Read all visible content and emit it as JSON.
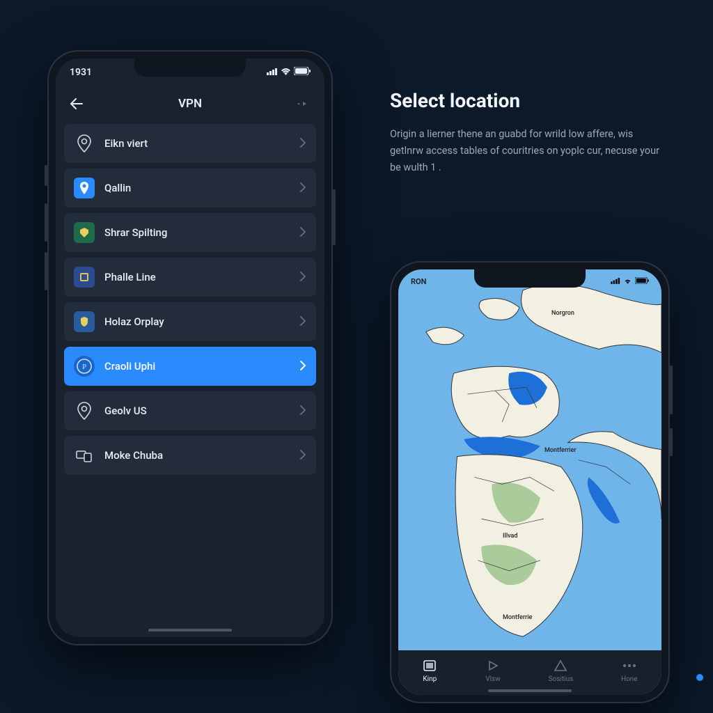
{
  "left_phone": {
    "status_time": "1931",
    "header_title": "VPN",
    "items": [
      {
        "label": "Eikn viert",
        "selected": false,
        "icon_name": "location-pin-outline-icon",
        "icon_bg": "transparent",
        "icon_fg": "#cfd8e3",
        "glyph": "◉"
      },
      {
        "label": "Qallin",
        "selected": false,
        "icon_name": "location-pin-filled-icon",
        "icon_bg": "#2a8bff",
        "icon_fg": "#ffffff",
        "glyph": "⦿"
      },
      {
        "label": "Shrar Spilting",
        "selected": false,
        "icon_name": "shield-emblem-icon",
        "icon_bg": "#1e6b4a",
        "icon_fg": "#e8d060",
        "glyph": "⬢"
      },
      {
        "label": "Phalle Line",
        "selected": false,
        "icon_name": "crest-icon",
        "icon_bg": "#2a4b8f",
        "icon_fg": "#e8c050",
        "glyph": "▦"
      },
      {
        "label": "Holaz Orplay",
        "selected": false,
        "icon_name": "badge-icon",
        "icon_bg": "#2a5b9f",
        "icon_fg": "#e8d060",
        "glyph": "◈"
      },
      {
        "label": "Craoli Uphi",
        "selected": true,
        "icon_name": "coin-emblem-icon",
        "icon_bg": "#1a66c8",
        "icon_fg": "#cfe4ff",
        "glyph": "℗"
      },
      {
        "label": "Geolv US",
        "selected": false,
        "icon_name": "location-pin-outline-icon",
        "icon_bg": "transparent",
        "icon_fg": "#cfd8e3",
        "glyph": "◉"
      },
      {
        "label": "Moke Chuba",
        "selected": false,
        "icon_name": "devices-icon",
        "icon_bg": "transparent",
        "icon_fg": "#cfd8e3",
        "glyph": "⧉"
      }
    ]
  },
  "headline": {
    "title": "Select location",
    "body": "Origin a lierner thene an guabd for wrild low affere, wis getlnrw access tables of couritries on yoplc cur, necuse your be wulth 1 ."
  },
  "right_phone": {
    "status_label": "RON",
    "map_labels": {
      "top": "Norgron",
      "mid": "Montferrier",
      "africa": "Illvad",
      "south": "Montferrie"
    },
    "tabs": [
      {
        "label": "Kinp",
        "icon_name": "map-tab-icon",
        "glyph": "▣",
        "active": true
      },
      {
        "label": "Vlsw",
        "icon_name": "view-tab-icon",
        "glyph": "▷",
        "active": false
      },
      {
        "label": "Sositius",
        "icon_name": "alert-tab-icon",
        "glyph": "△",
        "active": false
      },
      {
        "label": "Hone",
        "icon_name": "more-tab-icon",
        "glyph": "⋯",
        "active": false
      }
    ]
  }
}
